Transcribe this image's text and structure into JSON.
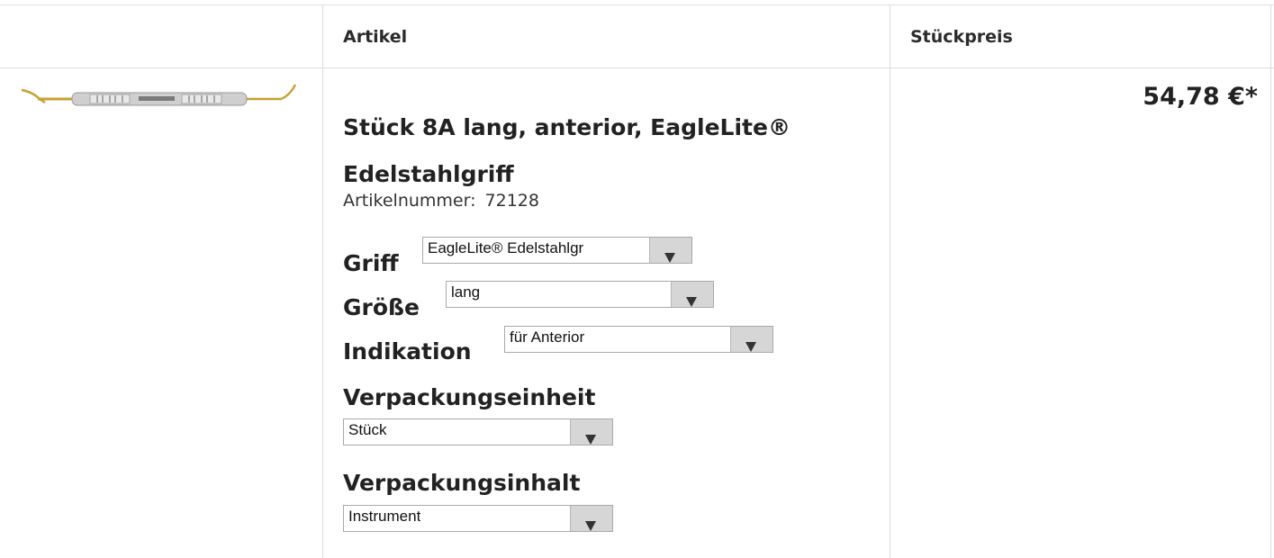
{
  "table": {
    "headers": {
      "article": "Artikel",
      "unit_price": "Stückpreis"
    }
  },
  "product": {
    "title": "Stück 8A lang, anterior, EagleLite® Edelstahlgriff",
    "article_number_label": "Artikelnummer:",
    "article_number": "72128",
    "price": "54,78 €*",
    "image": {
      "description": "dental instrument thumbnail",
      "handle_color": "#c8c8c8",
      "tip_color": "#c9a032"
    }
  },
  "options": {
    "griff": {
      "label": "Griff",
      "value": "EagleLite® Edelstahlgr"
    },
    "groesse": {
      "label": "Größe",
      "value": "lang"
    },
    "indikation": {
      "label": "Indikation",
      "value": "für Anterior"
    },
    "verpackungseinheit": {
      "label": "Verpackungseinheit",
      "value": "Stück"
    },
    "verpackungsinhalt": {
      "label": "Verpackungsinhalt",
      "value": "Instrument"
    }
  },
  "icons": {
    "dropdown": "chevron-down-icon"
  }
}
